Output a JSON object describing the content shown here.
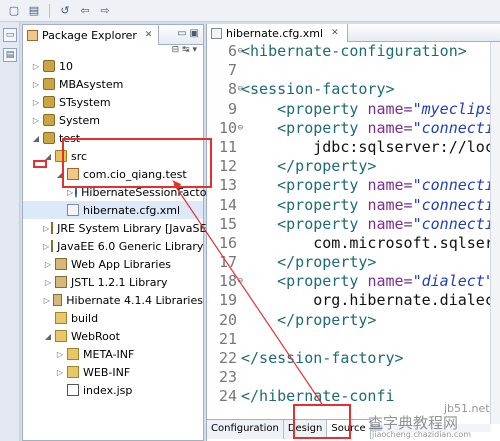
{
  "toolbar": {
    "icons": [
      "new-icon",
      "save-icon",
      "run-icon",
      "back-icon",
      "forward-icon"
    ]
  },
  "package_explorer": {
    "tab_label": "Package Explorer",
    "tab_close": "✕",
    "tree": [
      {
        "label": "10",
        "level": 0,
        "expanded": false,
        "icon": "project-icon"
      },
      {
        "label": "MBAsystem",
        "level": 0,
        "expanded": false,
        "icon": "project-icon"
      },
      {
        "label": "STsystem",
        "level": 0,
        "expanded": false,
        "icon": "project-icon"
      },
      {
        "label": "System",
        "level": 0,
        "expanded": false,
        "icon": "project-icon"
      },
      {
        "label": "test",
        "level": 0,
        "expanded": true,
        "icon": "project-icon"
      },
      {
        "label": "src",
        "level": 1,
        "expanded": true,
        "icon": "source-folder-icon"
      },
      {
        "label": "com.cio_qiang.test",
        "level": 2,
        "expanded": true,
        "icon": "package-icon"
      },
      {
        "label": "HibernateSessionFactory.jav",
        "level": 3,
        "expanded": false,
        "icon": "java-file-icon"
      },
      {
        "label": "hibernate.cfg.xml",
        "level": 2,
        "expanded": null,
        "icon": "xml-file-icon",
        "selected": true
      },
      {
        "label": "JRE System Library [JavaSE-1.6]",
        "level": 1,
        "expanded": false,
        "icon": "library-icon"
      },
      {
        "label": "JavaEE 6.0 Generic Library",
        "level": 1,
        "expanded": false,
        "icon": "library-icon"
      },
      {
        "label": "Web App Libraries",
        "level": 1,
        "expanded": false,
        "icon": "library-icon"
      },
      {
        "label": "JSTL 1.2.1 Library",
        "level": 1,
        "expanded": false,
        "icon": "library-icon"
      },
      {
        "label": "Hibernate 4.1.4 Libraries",
        "level": 1,
        "expanded": false,
        "icon": "library-icon"
      },
      {
        "label": "build",
        "level": 1,
        "expanded": null,
        "icon": "folder-icon"
      },
      {
        "label": "WebRoot",
        "level": 1,
        "expanded": true,
        "icon": "folder-icon"
      },
      {
        "label": "META-INF",
        "level": 2,
        "expanded": false,
        "icon": "folder-icon"
      },
      {
        "label": "WEB-INF",
        "level": 2,
        "expanded": false,
        "icon": "folder-icon"
      },
      {
        "label": "index.jsp",
        "level": 2,
        "expanded": null,
        "icon": "jsp-file-icon"
      }
    ]
  },
  "editor": {
    "tab_label": "hibernate.cfg.xml",
    "tab_close": "✕",
    "lines": [
      {
        "num": "6",
        "fold": "⊖",
        "parts": [
          [
            "tag",
            "<hibernate-configuration>"
          ]
        ]
      },
      {
        "num": "7",
        "fold": "",
        "parts": []
      },
      {
        "num": "8",
        "fold": "⊖",
        "parts": [
          [
            "tag",
            "<session-factory>"
          ]
        ]
      },
      {
        "num": "9",
        "fold": "",
        "parts": [
          [
            "txt",
            "    "
          ],
          [
            "tag",
            "<property "
          ],
          [
            "attr",
            "name="
          ],
          [
            "val",
            "\"myeclipse"
          ]
        ]
      },
      {
        "num": "10",
        "fold": "⊖",
        "parts": [
          [
            "txt",
            "    "
          ],
          [
            "tag",
            "<property "
          ],
          [
            "attr",
            "name="
          ],
          [
            "val",
            "\"connection"
          ]
        ]
      },
      {
        "num": "11",
        "fold": "",
        "parts": [
          [
            "txt",
            "        jdbc:sqlserver://loca"
          ]
        ]
      },
      {
        "num": "12",
        "fold": "",
        "parts": [
          [
            "txt",
            "    "
          ],
          [
            "tag",
            "</property>"
          ]
        ]
      },
      {
        "num": "13",
        "fold": "",
        "parts": [
          [
            "txt",
            "    "
          ],
          [
            "tag",
            "<property "
          ],
          [
            "attr",
            "name="
          ],
          [
            "val",
            "\"connection"
          ]
        ]
      },
      {
        "num": "14",
        "fold": "",
        "parts": [
          [
            "txt",
            "    "
          ],
          [
            "tag",
            "<property "
          ],
          [
            "attr",
            "name="
          ],
          [
            "val",
            "\"connection"
          ]
        ]
      },
      {
        "num": "15",
        "fold": "",
        "parts": [
          [
            "txt",
            "    "
          ],
          [
            "tag",
            "<property "
          ],
          [
            "attr",
            "name="
          ],
          [
            "val",
            "\"connection"
          ]
        ]
      },
      {
        "num": "16",
        "fold": "",
        "parts": [
          [
            "txt",
            "        com.microsoft.sqlserve"
          ]
        ]
      },
      {
        "num": "17",
        "fold": "",
        "parts": [
          [
            "txt",
            "    "
          ],
          [
            "tag",
            "</property>"
          ]
        ]
      },
      {
        "num": "18",
        "fold": "⊖",
        "parts": [
          [
            "txt",
            "    "
          ],
          [
            "tag",
            "<property "
          ],
          [
            "attr",
            "name="
          ],
          [
            "val",
            "\"dialect\""
          ],
          [
            "tag",
            ">"
          ]
        ]
      },
      {
        "num": "19",
        "fold": "",
        "parts": [
          [
            "txt",
            "        org.hibernate.dialect"
          ]
        ]
      },
      {
        "num": "20",
        "fold": "",
        "parts": [
          [
            "txt",
            "    "
          ],
          [
            "tag",
            "</property>"
          ]
        ]
      },
      {
        "num": "21",
        "fold": "",
        "parts": []
      },
      {
        "num": "22",
        "fold": "",
        "parts": [
          [
            "tag",
            "</session-factory>"
          ]
        ]
      },
      {
        "num": "23",
        "fold": "",
        "parts": []
      },
      {
        "num": "24",
        "fold": "",
        "parts": [
          [
            "tag",
            "</hibernate-confi"
          ]
        ]
      }
    ],
    "bottom_tabs": [
      "Configuration",
      "Design",
      "Source"
    ],
    "active_bottom_tab": "Source"
  },
  "watermark": {
    "line1": "查字典",
    "line2": "教程网",
    "site": "jiaocheng.chazidian.com",
    "jb51": "jb51.net"
  }
}
